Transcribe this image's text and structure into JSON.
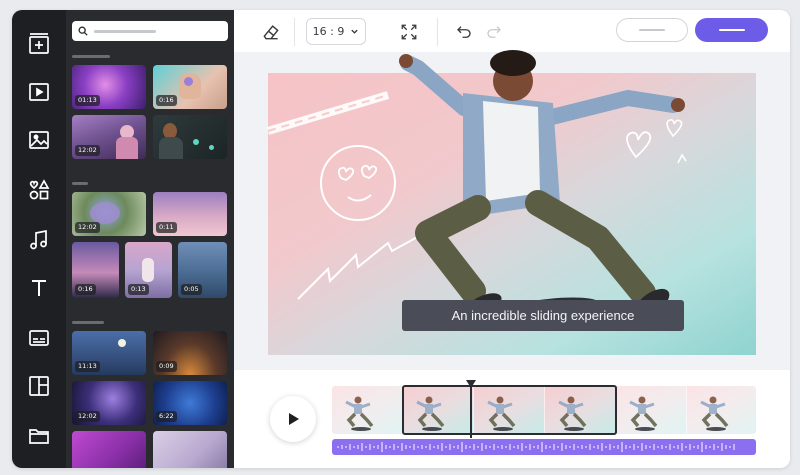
{
  "toolbar": {
    "aspect_ratio": "16 : 9",
    "icons": [
      "eraser-icon",
      "chevron-down-icon",
      "fullscreen-icon",
      "undo-icon",
      "redo-icon"
    ]
  },
  "rail": {
    "icons": [
      "add-frame-icon",
      "video-icon",
      "image-icon",
      "shapes-icon",
      "music-icon",
      "text-icon",
      "subtitles-icon",
      "layout-icon",
      "folder-icon"
    ]
  },
  "media": {
    "groups": [
      {
        "items": [
          {
            "duration": "01:13"
          },
          {
            "duration": "0:16"
          },
          {
            "duration": "12:02"
          },
          {
            "duration": ""
          }
        ]
      },
      {
        "items": [
          {
            "duration": "12:02"
          },
          {
            "duration": "0:11"
          },
          {
            "duration": "0:16"
          },
          {
            "duration": "0:13"
          },
          {
            "duration": "0:05"
          }
        ]
      },
      {
        "items": [
          {
            "duration": "11:13"
          },
          {
            "duration": "0:09"
          },
          {
            "duration": "12:02"
          },
          {
            "duration": "6:22"
          },
          {
            "duration": ""
          },
          {
            "duration": ""
          }
        ]
      }
    ]
  },
  "canvas": {
    "subtitle": "An incredible sliding experience"
  },
  "colors": {
    "accent": "#6c5ce7",
    "rail": "#1e1f22",
    "panel": "#2a2b2f",
    "audio_track": "#8b6ff0"
  }
}
